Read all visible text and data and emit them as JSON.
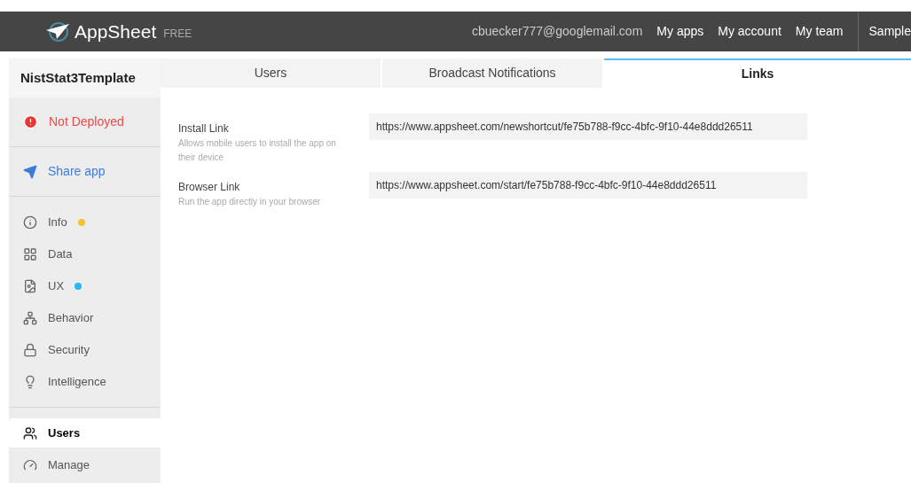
{
  "header": {
    "brand": "AppSheet",
    "plan": "FREE",
    "email": "cbuecker777@googlemail.com",
    "links": [
      "My apps",
      "My account",
      "My team"
    ],
    "cut_link": "Sample"
  },
  "sidebar": {
    "app_name": "NistStat3Template",
    "status": "Not Deployed",
    "share": "Share app",
    "items": [
      {
        "label": "Info",
        "selected": false,
        "color": "#fbc02d"
      },
      {
        "label": "Data",
        "selected": false
      },
      {
        "label": "UX",
        "selected": false,
        "color": "#29b6f6"
      },
      {
        "label": "Behavior",
        "selected": false
      },
      {
        "label": "Security",
        "selected": false
      },
      {
        "label": "Intelligence",
        "selected": false
      }
    ],
    "bottom_items": [
      {
        "label": "Users",
        "selected": true
      },
      {
        "label": "Manage",
        "selected": false
      }
    ]
  },
  "tabs": [
    {
      "label": "Users",
      "selected": false
    },
    {
      "label": "Broadcast Notifications",
      "selected": false
    },
    {
      "label": "Links",
      "selected": true
    }
  ],
  "links": [
    {
      "title": "Install Link",
      "description": "Allows mobile users to install the app on their device",
      "value": "https://www.appsheet.com/newshortcut/fe75b788-f9cc-4bfc-9f10-44e8ddd26511"
    },
    {
      "title": "Browser Link",
      "description": "Run the app directly in your browser",
      "value": "https://www.appsheet.com/start/fe75b788-f9cc-4bfc-9f10-44e8ddd26511"
    }
  ]
}
